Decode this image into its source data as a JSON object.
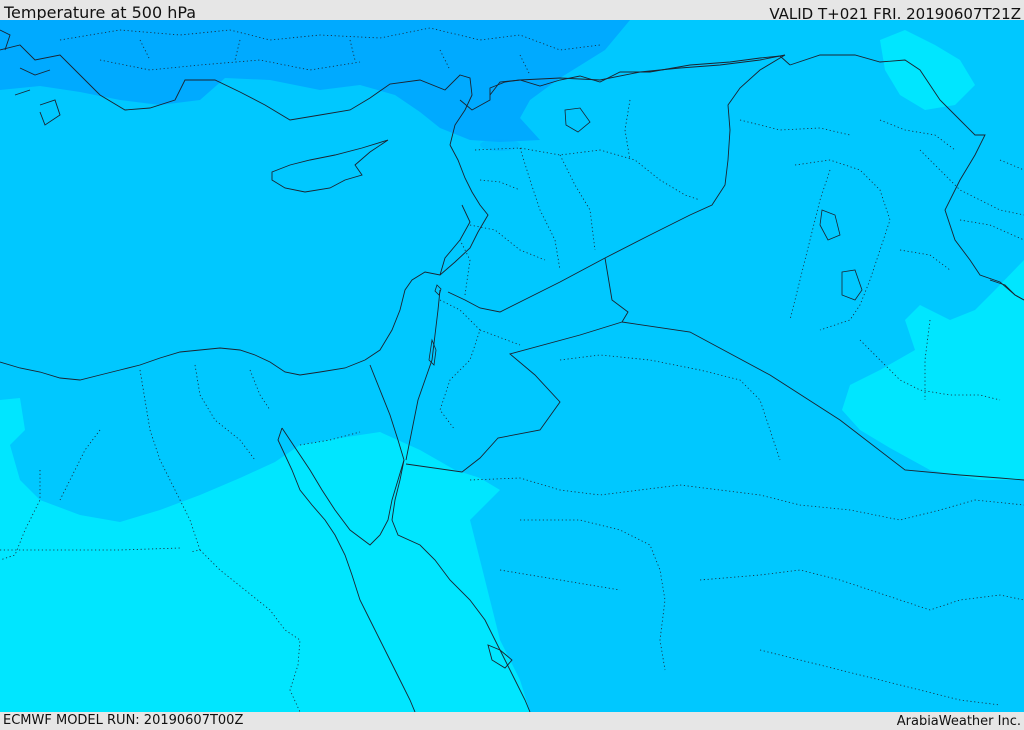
{
  "header": {
    "title": "Temperature at 500 hPa",
    "valid": "VALID T+021 FRI. 20190607T21Z"
  },
  "footer": {
    "model_run": "ECMWF MODEL RUN: 20190607T00Z",
    "credit": "ArabiaWeather Inc."
  },
  "colors": {
    "band_coldest": "#00aaff",
    "band_cold": "#00c8ff",
    "band_warm": "#00e6ff",
    "line": "#1a2330",
    "frame": "#e6e6e6"
  }
}
